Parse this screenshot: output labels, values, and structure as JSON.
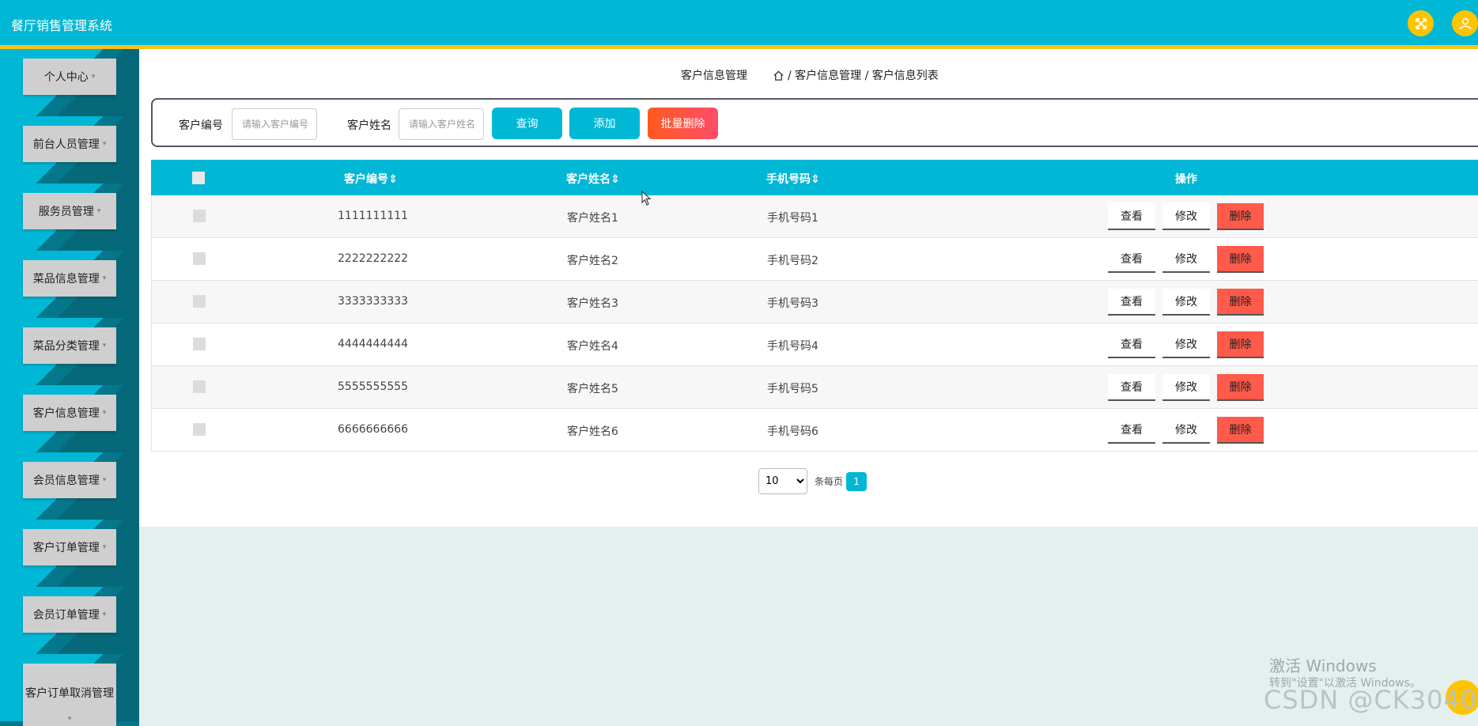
{
  "header": {
    "app_title": "餐厅销售管理系统",
    "icons": [
      "fullscreen-icon",
      "user-icon"
    ],
    "colors": {
      "bar": "#00b7d6",
      "accent_line": "#f6c318",
      "icon_bg": "#ffc400"
    }
  },
  "sidebar": {
    "items": [
      {
        "label": "个人中心"
      },
      {
        "label": "前台人员管理"
      },
      {
        "label": "服务员管理"
      },
      {
        "label": "菜品信息管理"
      },
      {
        "label": "菜品分类管理"
      },
      {
        "label": "客户信息管理"
      },
      {
        "label": "会员信息管理"
      },
      {
        "label": "客户订单管理"
      },
      {
        "label": "会员订单管理"
      },
      {
        "label": "客户订单取消管理"
      }
    ],
    "caret": "▾"
  },
  "breadcrumb": {
    "title": "客户信息管理",
    "path": "/ 客户信息管理 / 客户信息列表"
  },
  "search": {
    "customer_no_label": "客户编号",
    "customer_no_placeholder": "请输入客户编号",
    "customer_name_label": "客户姓名",
    "customer_name_placeholder": "请输入客户姓名",
    "query_label": "查询",
    "add_label": "添加",
    "batch_delete_label": "批量删除"
  },
  "table": {
    "columns": [
      "客户编号",
      "客户姓名",
      "手机号码",
      "操作"
    ],
    "sort_glyph": "⇕",
    "rows": [
      {
        "no": "1111111111",
        "name": "客户姓名1",
        "phone": "手机号码1"
      },
      {
        "no": "2222222222",
        "name": "客户姓名2",
        "phone": "手机号码2"
      },
      {
        "no": "3333333333",
        "name": "客户姓名3",
        "phone": "手机号码3"
      },
      {
        "no": "4444444444",
        "name": "客户姓名4",
        "phone": "手机号码4"
      },
      {
        "no": "5555555555",
        "name": "客户姓名5",
        "phone": "手机号码5"
      },
      {
        "no": "6666666666",
        "name": "客户姓名6",
        "phone": "手机号码6"
      }
    ],
    "actions": {
      "view": "查看",
      "edit": "修改",
      "delete": "删除"
    }
  },
  "pagination": {
    "page_size": "10",
    "per_page_label": "条每页",
    "current_page": "1"
  },
  "watermark": {
    "activate_title": "激活 Windows",
    "activate_hint": "转到\"设置\"以激活 Windows。",
    "csdn": "CSDN @CK3040"
  }
}
